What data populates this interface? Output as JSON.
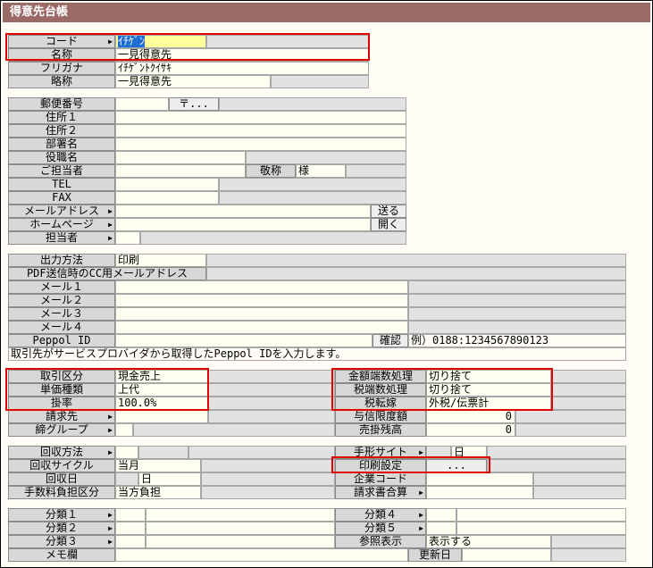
{
  "window": {
    "title": "得意先台帳"
  },
  "basic": {
    "code_label": "コード",
    "code_value": "ｲﾁｹﾞﾝ",
    "name_label": "名称",
    "name_value": "一見得意先",
    "furigana_label": "フリガナ",
    "furigana_value": "ｲﾁｹﾞﾝﾄｸｲｻｷ",
    "short_label": "略称",
    "short_value": "一見得意先"
  },
  "address": {
    "postal_label": "郵便番号",
    "postal_button": "〒...",
    "addr1_label": "住所１",
    "addr2_label": "住所２",
    "dept_label": "部署名",
    "title_label": "役職名",
    "contact_label": "ご担当者",
    "honorific_label": "敬称",
    "honorific_value": "様",
    "tel_label": "TEL",
    "fax_label": "FAX",
    "email_label": "メールアドレス",
    "send_button": "送る",
    "homepage_label": "ホームページ",
    "open_button": "開く",
    "staff_label": "担当者"
  },
  "output": {
    "method_label": "出力方法",
    "method_value": "印刷",
    "pdf_cc_label": "PDF送信時のCC用メールアドレス",
    "mail1_label": "メール１",
    "mail2_label": "メール２",
    "mail3_label": "メール３",
    "mail4_label": "メール４",
    "peppol_label": "Peppol ID",
    "confirm_label": "確認",
    "peppol_example": "例）0188:1234567890123",
    "peppol_note": "取引先がサービスプロバイダから取得したPeppol IDを入力します。"
  },
  "trade": {
    "type_label": "取引区分",
    "type_value": "現金売上",
    "price_label": "単価種類",
    "price_value": "上代",
    "rate_label": "掛率",
    "rate_value": "100.0",
    "rate_unit": "%",
    "billing_label": "請求先",
    "group_label": "締グループ",
    "rounding_label": "金額端数処理",
    "rounding_value": "切り捨て",
    "tax_rounding_label": "税端数処理",
    "tax_rounding_value": "切り捨て",
    "tax_transfer_label": "税転嫁",
    "tax_transfer_value": "外税/伝票計",
    "credit_label": "与信限度額",
    "credit_value": "0",
    "balance_label": "売掛残高",
    "balance_value": "0"
  },
  "collection": {
    "method_label": "回収方法",
    "cycle_label": "回収サイクル",
    "cycle_value": "当月",
    "day_label": "回収日",
    "day_value": "日",
    "fee_label": "手数料負担区分",
    "fee_value": "当方負担",
    "bill_site_label": "手形サイト",
    "bill_site_unit": "日",
    "print_label": "印刷設定",
    "print_button": "...",
    "company_code_label": "企業コード",
    "invoice_merge_label": "請求書合算"
  },
  "categories": {
    "cat1_label": "分類１",
    "cat2_label": "分類２",
    "cat3_label": "分類３",
    "cat4_label": "分類４",
    "cat5_label": "分類５",
    "ref_label": "参照表示",
    "ref_value": "表示する",
    "memo_label": "メモ欄",
    "updated_label": "更新日"
  },
  "colors": {
    "titlebar": "#9a6a66",
    "highlight": "#e00000",
    "selection": "#1e6ed4"
  }
}
